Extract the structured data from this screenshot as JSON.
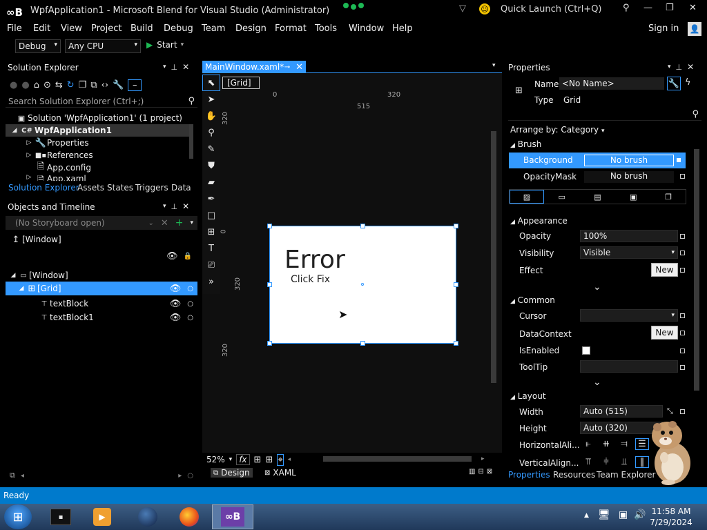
{
  "window": {
    "title": "WpfApplication1 - Microsoft Blend for Visual Studio (Administrator)",
    "quick_launch": "Quick Launch (Ctrl+Q)"
  },
  "menu": [
    "File",
    "Edit",
    "View",
    "Project",
    "Build",
    "Debug",
    "Team",
    "Design",
    "Format",
    "Tools",
    "Window",
    "Help"
  ],
  "signin": "Sign in",
  "toolbar": {
    "config": "Debug",
    "platform": "Any CPU",
    "start": "Start"
  },
  "solution_explorer": {
    "title": "Solution Explorer",
    "search_placeholder": "Search Solution Explorer (Ctrl+;)",
    "items": [
      {
        "label": "Solution 'WpfApplication1' (1 project)"
      },
      {
        "label": "WpfApplication1"
      },
      {
        "label": "Properties"
      },
      {
        "label": "References"
      },
      {
        "label": "App.config"
      },
      {
        "label": "App.xaml"
      }
    ],
    "tabs": [
      "Solution Explorer",
      "Assets",
      "States",
      "Triggers",
      "Data"
    ]
  },
  "objects_timeline": {
    "title": "Objects and Timeline",
    "storyboard": "(No Storyboard open)",
    "root": "[Window]",
    "tree": [
      {
        "label": "[Window]"
      },
      {
        "label": "[Grid]"
      },
      {
        "label": "textBlock"
      },
      {
        "label": "textBlock1"
      }
    ]
  },
  "designer": {
    "doc_tab": "MainWindow.xaml*",
    "breadcrumb": "[Grid]",
    "ruler_top": [
      "0",
      "320",
      "515"
    ],
    "ruler_left": [
      "320",
      "0",
      "320",
      "320"
    ],
    "artboard_text": {
      "title": "Error",
      "subtitle": "Click Fix"
    },
    "zoom": "52%",
    "fx": "fx",
    "view_tabs": [
      "Design",
      "XAML"
    ]
  },
  "properties": {
    "title": "Properties",
    "name_label": "Name",
    "name_value": "<No Name>",
    "type_label": "Type",
    "type_value": "Grid",
    "arrange_by": "Arrange by: Category",
    "brush": {
      "section": "Brush",
      "background_label": "Background",
      "background_value": "No brush",
      "opacitymask_label": "OpacityMask",
      "opacitymask_value": "No brush"
    },
    "appearance": {
      "section": "Appearance",
      "opacity_label": "Opacity",
      "opacity_value": "100%",
      "visibility_label": "Visibility",
      "visibility_value": "Visible",
      "effect_label": "Effect",
      "new": "New"
    },
    "common": {
      "section": "Common",
      "cursor_label": "Cursor",
      "datacontext_label": "DataContext",
      "isenabled_label": "IsEnabled",
      "tooltip_label": "ToolTip",
      "new": "New"
    },
    "layout": {
      "section": "Layout",
      "width_label": "Width",
      "width_value": "Auto (515)",
      "height_label": "Height",
      "height_value": "Auto (320)",
      "halign_label": "HorizontalAli...",
      "valign_label": "VerticalAlign..."
    },
    "tabs": [
      "Properties",
      "Resources",
      "Team Explorer"
    ]
  },
  "status": "Ready",
  "clock": {
    "time": "11:58 AM",
    "date": "7/29/2024"
  },
  "colors": {
    "accent": "#3399ff",
    "statusbar": "#007acc"
  }
}
